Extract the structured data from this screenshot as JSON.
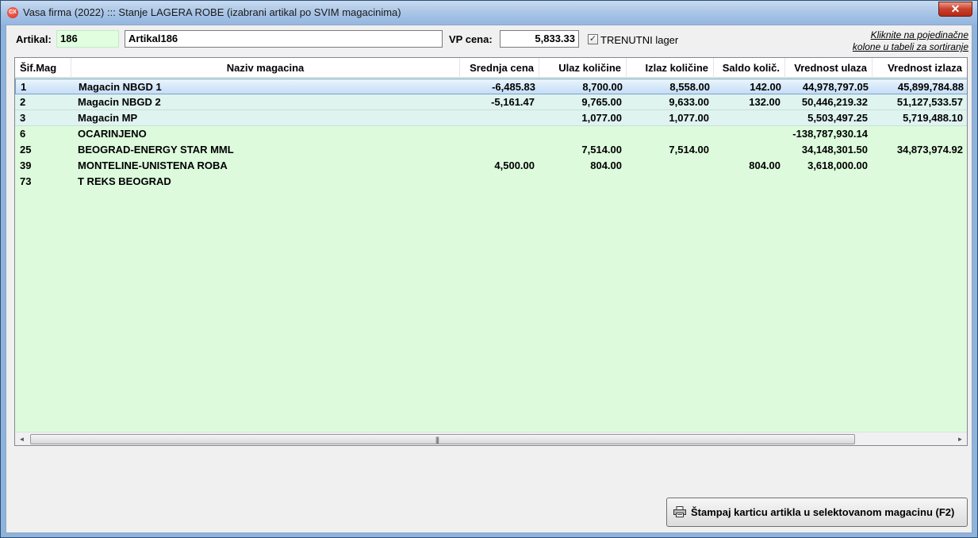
{
  "window": {
    "title": "Vasa firma (2022) ::: Stanje LAGERA ROBE (izabrani artikal po SVIM magacinima)",
    "close_glyph": "✕",
    "app_icon_text": "CX"
  },
  "header": {
    "artikal_label": "Artikal:",
    "artikal_code": "186",
    "artikal_name": "Artikal186",
    "vp_cena_label": "VP cena:",
    "vp_cena_value": "5,833.33",
    "trenutni_checked": true,
    "trenutni_label": "TRENUTNI lager",
    "sort_hint_line1": "Kliknite na pojedinačne",
    "sort_hint_line2": "kolone u tabeli za sortiranje"
  },
  "grid": {
    "columns": [
      "Šif.Mag",
      "Naziv magacina",
      "Srednja cena",
      "Ulaz količine",
      "Izlaz količine",
      "Saldo količ.",
      "Vrednost ulaza",
      "Vrednost izlaza"
    ],
    "rows": [
      [
        "1",
        "Magacin NBGD 1",
        "-6,485.83",
        "8,700.00",
        "8,558.00",
        "142.00",
        "44,978,797.05",
        "45,899,784.88"
      ],
      [
        "2",
        "Magacin NBGD 2",
        "-5,161.47",
        "9,765.00",
        "9,633.00",
        "132.00",
        "50,446,219.32",
        "51,127,533.57"
      ],
      [
        "3",
        "Magacin MP",
        "",
        "1,077.00",
        "1,077.00",
        "",
        "5,503,497.25",
        "5,719,488.10"
      ],
      [
        "6",
        "OCARINJENO",
        "",
        "",
        "",
        "",
        "-138,787,930.14",
        ""
      ],
      [
        "25",
        "BEOGRAD-ENERGY STAR MML",
        "",
        "7,514.00",
        "7,514.00",
        "",
        "34,148,301.50",
        "34,873,974.92"
      ],
      [
        "39",
        "MONTELINE-UNISTENA ROBA",
        "4,500.00",
        "804.00",
        "",
        "804.00",
        "3,618,000.00",
        ""
      ],
      [
        "73",
        "T REKS BEOGRAD",
        "",
        "",
        "",
        "",
        "",
        ""
      ]
    ],
    "selected_row": 0
  },
  "scrollbar": {
    "left_arrow": "◄",
    "right_arrow": "►",
    "grip": "|||"
  },
  "footer": {
    "print_button_label": "Štampaj karticu artikla u selektovanom magacinu (F2)"
  }
}
